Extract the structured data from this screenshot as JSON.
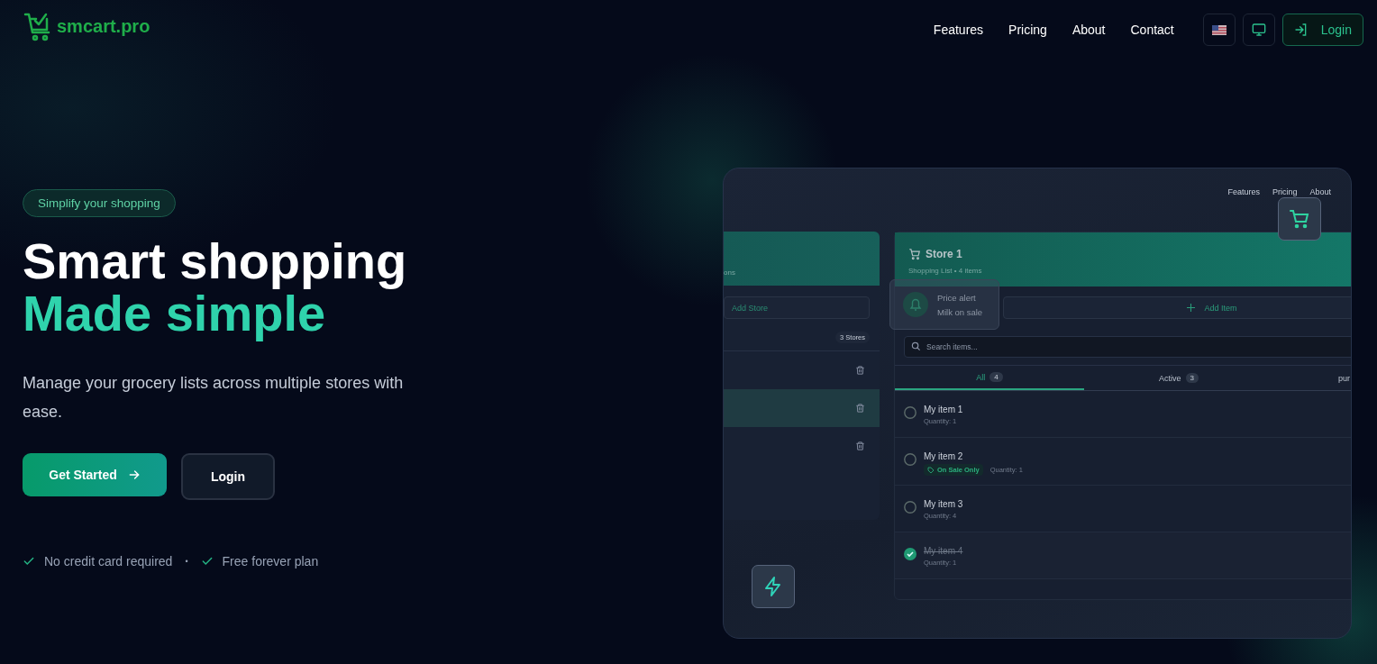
{
  "logo": {
    "text": "smcart.pro"
  },
  "nav": {
    "links": [
      "Features",
      "Pricing",
      "About",
      "Contact"
    ],
    "login": "Login"
  },
  "hero": {
    "badge": "Simplify your shopping",
    "title_line1": "Smart shopping",
    "title_line2": "Made simple",
    "subtitle": "Manage your grocery lists across multiple stores with ease.",
    "primary_button": "Get Started",
    "secondary_button": "Login",
    "perks": [
      "No credit card required",
      "Free forever plan"
    ],
    "perk_separator": "•"
  },
  "preview": {
    "nav_links": [
      "Features",
      "Pricing",
      "About"
    ],
    "stores_panel": {
      "subtitle": "ons",
      "add_button": "Add Store",
      "count": "3 Stores",
      "rows": [
        {
          "selected": false
        },
        {
          "selected": true
        },
        {
          "selected": false
        }
      ]
    },
    "list_panel": {
      "title": "Store 1",
      "subtitle": "Shopping List • 4 items",
      "add_button": "Add Item",
      "search_placeholder": "Search items...",
      "tabs": [
        {
          "label": "All",
          "count": "4",
          "selected": true
        },
        {
          "label": "Active",
          "count": "3",
          "selected": false
        },
        {
          "label": "pur",
          "selected": false
        }
      ],
      "items": [
        {
          "name": "My item 1",
          "quantity": "Quantity: 1",
          "checked": false
        },
        {
          "name": "My item 2",
          "tag": "On Sale Only",
          "quantity": "Quantity: 1",
          "checked": false
        },
        {
          "name": "My item 3",
          "quantity": "Quantity: 4",
          "checked": false
        },
        {
          "name": "My item 4",
          "quantity": "Quantity: 1",
          "checked": true
        }
      ]
    },
    "toast": {
      "title": "Price alert",
      "message": "Milk on sale"
    }
  }
}
